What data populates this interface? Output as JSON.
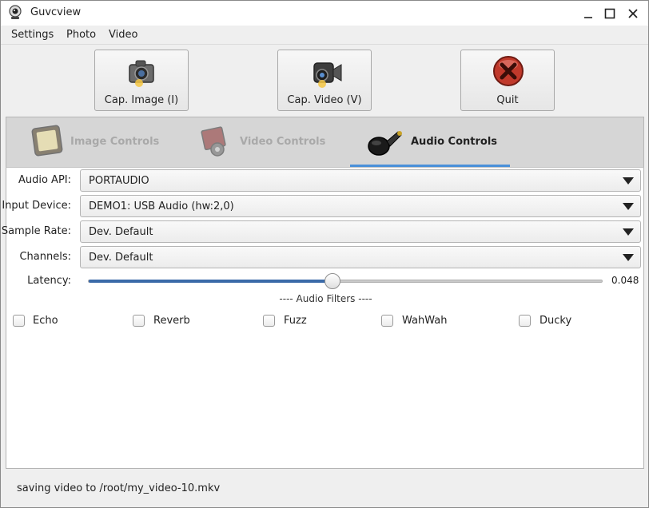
{
  "window": {
    "title": "Guvcview"
  },
  "menu": {
    "items": [
      "Settings",
      "Photo",
      "Video"
    ]
  },
  "toolbar": {
    "cap_image_label": "Cap. Image (I)",
    "cap_video_label": "Cap. Video (V)",
    "quit_label": "Quit"
  },
  "tabs": [
    {
      "label": "Image Controls",
      "icon": "image-controls-icon",
      "active": false
    },
    {
      "label": "Video Controls",
      "icon": "video-controls-icon",
      "active": false
    },
    {
      "label": "Audio Controls",
      "icon": "microphone-icon",
      "active": true
    }
  ],
  "audio": {
    "api": {
      "label": "Audio API:",
      "value": "PORTAUDIO"
    },
    "input_device": {
      "label": "Input Device:",
      "value": "DEMO1: USB Audio (hw:2,0)"
    },
    "sample_rate": {
      "label": "Sample Rate:",
      "value": "Dev. Default"
    },
    "channels": {
      "label": "Channels:",
      "value": "Dev. Default"
    },
    "latency": {
      "label": "Latency:",
      "value": "0.048",
      "slider_fraction": 0.475
    }
  },
  "filters": {
    "title": "---- Audio Filters ----",
    "items": [
      {
        "label": "Echo",
        "checked": false
      },
      {
        "label": "Reverb",
        "checked": false
      },
      {
        "label": "Fuzz",
        "checked": false
      },
      {
        "label": "WahWah",
        "checked": false
      },
      {
        "label": "Ducky",
        "checked": false
      }
    ]
  },
  "status": {
    "text": "saving video to /root/my_video-10.mkv"
  },
  "colors": {
    "accent": "#4a90d9",
    "slider_fill": "#3b6aa8",
    "quit_red": "#c0392b"
  }
}
